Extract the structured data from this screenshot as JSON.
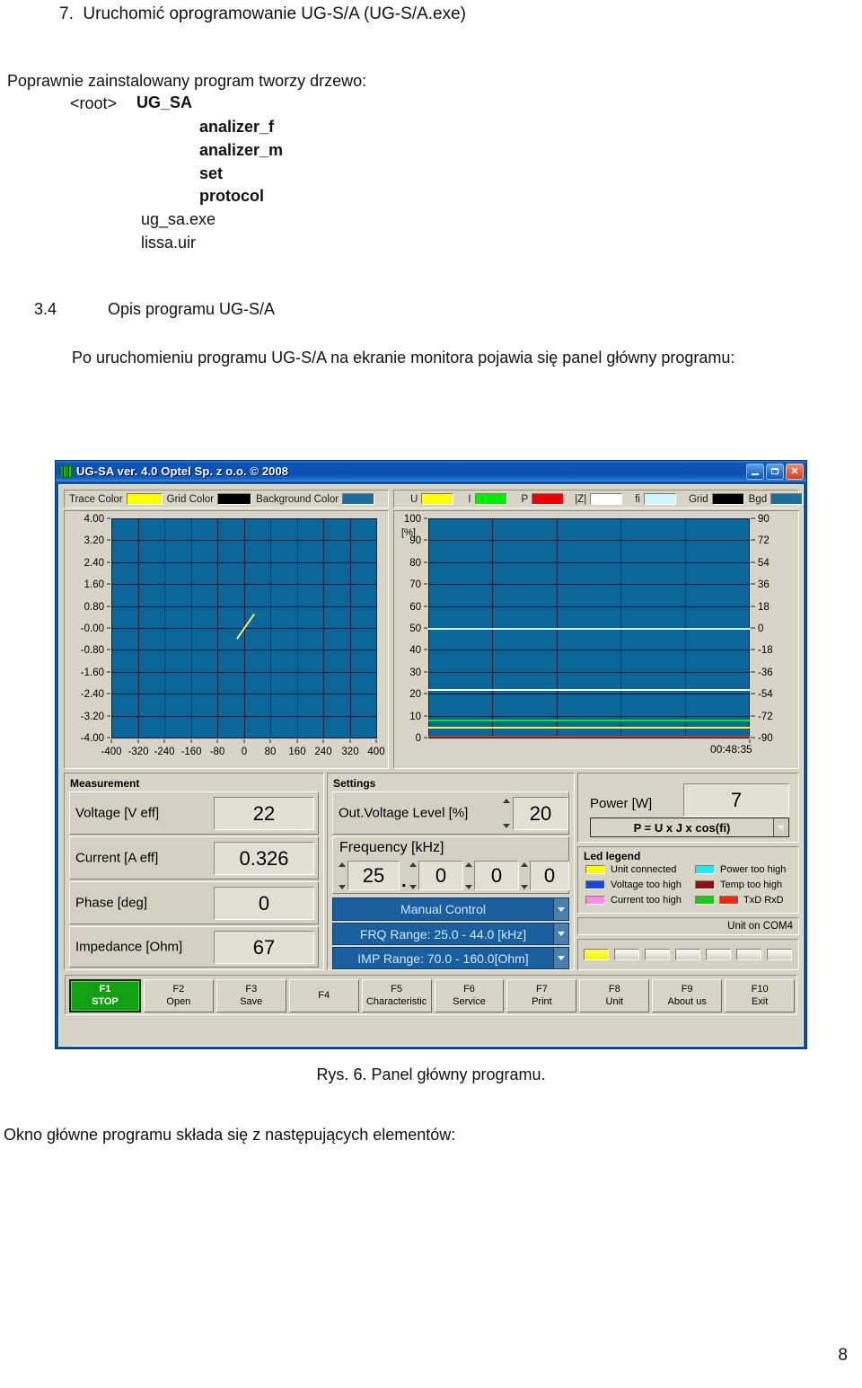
{
  "document": {
    "heading": "7.  Uruchomić oprogramowanie UG-S/A (UG-S/A.exe)",
    "intro": "Poprawnie zainstalowany program tworzy drzewo:",
    "tree": {
      "root": "<root>",
      "root_name": "UG_SA",
      "children": [
        "analizer_f",
        "analizer_m",
        "set",
        "protocol"
      ],
      "files": [
        "ug_sa.exe",
        "lissa.uir"
      ]
    },
    "section_number": "3.4",
    "section_title": "Opis programu UG-S/A",
    "paragraph": "Po uruchomieniu programu UG-S/A na ekranie monitora pojawia się panel główny programu:",
    "figure_caption": "Rys. 6. Panel główny programu.",
    "closing": "Okno główne programu składa się z następujących elementów:",
    "page_number": "8"
  },
  "app": {
    "title": "UG-SA ver. 4.0  Optel Sp. z o.o. © 2008",
    "icon": "app-grid-icon",
    "window_buttons": {
      "minimize": "minimize-icon",
      "maximize": "maximize-icon",
      "close": "close-icon"
    },
    "lissajous_toolbar": [
      {
        "label": "Trace Color",
        "color": "#ffff00"
      },
      {
        "label": "Grid Color",
        "color": "#000000"
      },
      {
        "label": "Background Color",
        "color": "#1a6e9e"
      }
    ],
    "graph_toolbar": [
      {
        "label": "U",
        "color": "#ffff00"
      },
      {
        "label": "I",
        "color": "#00ee00"
      },
      {
        "label": "P",
        "color": "#ee0000"
      },
      {
        "label": "|Z|",
        "color": "#ffffff"
      },
      {
        "label": "fi",
        "color": "#ccf5ff"
      },
      {
        "label": "Grid",
        "color": "#000000"
      },
      {
        "label": "Bgd",
        "color": "#1a6e9e"
      }
    ],
    "measurement": {
      "title": "Measurement",
      "rows": [
        {
          "label": "Voltage [V eff]",
          "value": "22"
        },
        {
          "label": "Current [A eff]",
          "value": "0.326"
        },
        {
          "label": "Phase [deg]",
          "value": "0"
        },
        {
          "label": "Impedance [Ohm]",
          "value": "67"
        }
      ]
    },
    "settings": {
      "title": "Settings",
      "out_voltage_label": "Out.Voltage Level [%]",
      "out_voltage_value": "20",
      "frequency_label": "Frequency [kHz]",
      "frequency_digits": [
        "25",
        "0",
        "0",
        "0"
      ],
      "frequency_separator": ".",
      "mode_dropdown": "Manual Control",
      "frq_range_dropdown": "FRQ Range: 25.0 - 44.0 [kHz]",
      "imp_range_dropdown": "IMP Range: 70.0 - 160.0[Ohm]"
    },
    "power": {
      "label": "Power [W]",
      "value": "7",
      "formula_dropdown": "P = U x J x cos(fi)"
    },
    "led_legend": {
      "title": "Led legend",
      "items": [
        {
          "label": "Unit connected",
          "color": "#ffff00"
        },
        {
          "label": "Voltage too high",
          "color": "#1a48d8"
        },
        {
          "label": "Current too high",
          "color": "#ff8ae8"
        },
        {
          "label": "Power too high",
          "color": "#23e8f0"
        },
        {
          "label": "Temp too high",
          "color": "#8e0f0f"
        },
        {
          "label": "TxD RxD",
          "color": "#16cc16",
          "color2": "#ee2b10"
        }
      ]
    },
    "status": {
      "text": "Unit on COM4"
    },
    "led_strip": {
      "count": 7,
      "lit_index": 0,
      "lit_color": "#f2f200"
    },
    "function_keys": [
      {
        "key": "F1",
        "name": "STOP",
        "active": true
      },
      {
        "key": "F2",
        "name": "Open",
        "active": false
      },
      {
        "key": "F3",
        "name": "Save",
        "active": false
      },
      {
        "key": "F4",
        "name": "",
        "active": false
      },
      {
        "key": "F5",
        "name": "Characteristic",
        "active": false
      },
      {
        "key": "F6",
        "name": "Service",
        "active": false
      },
      {
        "key": "F7",
        "name": "Print",
        "active": false
      },
      {
        "key": "F8",
        "name": "Unit",
        "active": false
      },
      {
        "key": "F9",
        "name": "About us",
        "active": false
      },
      {
        "key": "F10",
        "name": "Exit",
        "active": false
      }
    ]
  },
  "chart_data": [
    {
      "type": "line",
      "name": "lissajous-plot",
      "title": "",
      "xlabel": "",
      "ylabel": "",
      "xlim": [
        -400,
        400
      ],
      "ylim": [
        -4.0,
        4.0
      ],
      "xticks": [
        -400,
        -320,
        -240,
        -160,
        -80,
        0,
        80,
        160,
        240,
        320,
        400
      ],
      "yticks": [
        4.0,
        3.2,
        2.4,
        1.6,
        0.8,
        -0.0,
        -0.8,
        -1.6,
        -2.4,
        -3.2,
        -4.0
      ],
      "xticklabels": [
        "-400",
        "-320",
        "-240",
        "-160",
        "-80",
        "0",
        "80",
        "160",
        "240",
        "320",
        "400"
      ],
      "yticklabels": [
        "4.00",
        "3.20",
        "2.40",
        "1.60",
        "0.80",
        "-0.00",
        "-0.80",
        "-1.60",
        "-2.40",
        "-3.20",
        "-4.00"
      ],
      "grid": true,
      "background": "#0b6699",
      "grid_color": "#0a1b33",
      "series": [
        {
          "name": "trace",
          "color": "#e8f06a",
          "x": [
            -22,
            30
          ],
          "y": [
            -0.38,
            0.52
          ]
        }
      ]
    },
    {
      "type": "line",
      "name": "timeline-plot",
      "title": "",
      "ylabel": "[%]",
      "ylim": [
        0,
        100
      ],
      "yticks": [
        0,
        10,
        20,
        30,
        40,
        50,
        60,
        70,
        80,
        90,
        100
      ],
      "yticklabels": [
        "0",
        "10",
        "20",
        "30",
        "40",
        "50",
        "60",
        "70",
        "80",
        "90",
        "100"
      ],
      "y2lim": [
        -90,
        90
      ],
      "y2ticks": [
        -90,
        -72,
        -54,
        -36,
        -18,
        0,
        18,
        36,
        54,
        72,
        90
      ],
      "y2ticklabels_top_to_bottom": [
        "90",
        "72",
        "54",
        "36",
        "18",
        "0",
        "-18",
        "-36",
        "-54",
        "-72",
        "-90"
      ],
      "xlabel": "00:48:35",
      "grid": true,
      "background": "#0b6699",
      "grid_color": "#0a1b33",
      "series": [
        {
          "name": "fi",
          "color": "#ccf5ff",
          "constant_value": 50
        },
        {
          "name": "|Z|",
          "color": "#ffffff",
          "constant_value": 22
        },
        {
          "name": "I",
          "color": "#00ee00",
          "constant_value": 8
        },
        {
          "name": "U",
          "color": "#ffff00",
          "constant_value": 5
        },
        {
          "name": "P",
          "color": "#c83232",
          "constant_value": 1
        }
      ]
    }
  ]
}
